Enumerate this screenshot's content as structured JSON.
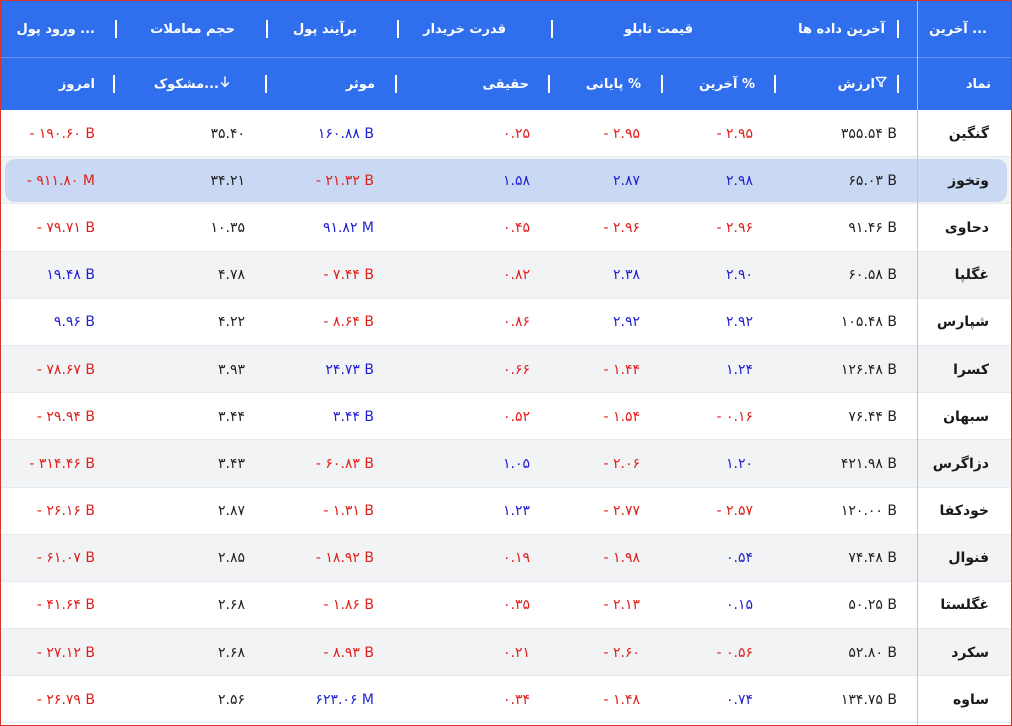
{
  "header_top": {
    "last": "آخرین ...",
    "last_data": "آخرین داده ها",
    "board_price": "قیمت تابلو",
    "buyer_power": "قدرت خریدار",
    "money_flow": "برآیند پول",
    "trade_volume": "حجم معاملات",
    "money_inflow": "ورود پول ..."
  },
  "header_sub": {
    "symbol": "نماد",
    "value": "ارزش",
    "last_pct": "آخرین %",
    "close_pct": "پایانی %",
    "real": "حقیقی",
    "effective": "موثر",
    "suspect": "مشکوک...",
    "today": "امروز"
  },
  "icons": {
    "filter": "filter-icon",
    "sort": "arrow-down-icon"
  },
  "colors": {
    "header_bg": "#2f6fed",
    "negative": "#e0201b",
    "positive": "#1f1fd1",
    "selected_row": "#c9d8f3"
  },
  "selected_row_index": 1,
  "rows": [
    {
      "symbol": "گنگین",
      "value": "۳۵۵.۵۴ B",
      "last_pct": "- ۲.۹۵",
      "close_pct": "- ۲.۹۵",
      "real": "۰.۲۵",
      "effective": "۱۶۰.۸۸ B",
      "suspect": "۳۵.۴۰",
      "today": "- ۱۹۰.۶۰ B",
      "c": [
        "neg",
        "neg",
        "neg",
        "pos",
        "neu",
        "neg"
      ]
    },
    {
      "symbol": "وتخوز",
      "value": "۶۵.۰۳ B",
      "last_pct": "۲.۹۸",
      "close_pct": "۲.۸۷",
      "real": "۱.۵۸",
      "effective": "- ۲۱.۳۲ B",
      "suspect": "۳۴.۲۱",
      "today": "- ۹۱۱.۸۰ M",
      "c": [
        "pos",
        "pos",
        "pos",
        "neg",
        "neu",
        "neg"
      ]
    },
    {
      "symbol": "دحاوی",
      "value": "۹۱.۴۶ B",
      "last_pct": "- ۲.۹۶",
      "close_pct": "- ۲.۹۶",
      "real": "۰.۴۵",
      "effective": "۹۱.۸۲ M",
      "suspect": "۱۰.۳۵",
      "today": "- ۷۹.۷۱ B",
      "c": [
        "neg",
        "neg",
        "neg",
        "pos",
        "neu",
        "neg"
      ]
    },
    {
      "symbol": "غگلپا",
      "value": "۶۰.۵۸ B",
      "last_pct": "۲.۹۰",
      "close_pct": "۲.۳۸",
      "real": "۰.۸۲",
      "effective": "- ۷.۴۴ B",
      "suspect": "۴.۷۸",
      "today": "۱۹.۴۸ B",
      "c": [
        "pos",
        "pos",
        "neg",
        "neg",
        "neu",
        "pos"
      ]
    },
    {
      "symbol": "شپارس",
      "value": "۱۰۵.۴۸ B",
      "last_pct": "۲.۹۲",
      "close_pct": "۲.۹۲",
      "real": "۰.۸۶",
      "effective": "- ۸.۶۴ B",
      "suspect": "۴.۲۲",
      "today": "۹.۹۶ B",
      "c": [
        "pos",
        "pos",
        "neg",
        "neg",
        "neu",
        "pos"
      ]
    },
    {
      "symbol": "کسرا",
      "value": "۱۲۶.۴۸ B",
      "last_pct": "۱.۲۴",
      "close_pct": "- ۱.۴۴",
      "real": "۰.۶۶",
      "effective": "۲۴.۷۳ B",
      "suspect": "۳.۹۳",
      "today": "- ۷۸.۶۷ B",
      "c": [
        "pos",
        "neg",
        "neg",
        "pos",
        "neu",
        "neg"
      ]
    },
    {
      "symbol": "سبهان",
      "value": "۷۶.۴۴ B",
      "last_pct": "- ۰.۱۶",
      "close_pct": "- ۱.۵۴",
      "real": "۰.۵۲",
      "effective": "۳.۴۴ B",
      "suspect": "۳.۴۴",
      "today": "- ۲۹.۹۴ B",
      "c": [
        "neg",
        "neg",
        "neg",
        "pos",
        "neu",
        "neg"
      ]
    },
    {
      "symbol": "دزاگرس",
      "value": "۴۲۱.۹۸ B",
      "last_pct": "۱.۲۰",
      "close_pct": "- ۲.۰۶",
      "real": "۱.۰۵",
      "effective": "- ۶۰.۸۳ B",
      "suspect": "۳.۴۳",
      "today": "- ۳۱۴.۴۶ B",
      "c": [
        "pos",
        "neg",
        "pos",
        "neg",
        "neu",
        "neg"
      ]
    },
    {
      "symbol": "خودکفا",
      "value": "۱۲۰.۰۰ B",
      "last_pct": "- ۲.۵۷",
      "close_pct": "- ۲.۷۷",
      "real": "۱.۲۳",
      "effective": "- ۱.۳۱ B",
      "suspect": "۲.۸۷",
      "today": "- ۲۶.۱۶ B",
      "c": [
        "neg",
        "neg",
        "pos",
        "neg",
        "neu",
        "neg"
      ]
    },
    {
      "symbol": "فنوال",
      "value": "۷۴.۴۸ B",
      "last_pct": "۰.۵۴",
      "close_pct": "- ۱.۹۸",
      "real": "۰.۱۹",
      "effective": "- ۱۸.۹۲ B",
      "suspect": "۲.۸۵",
      "today": "- ۶۱.۰۷ B",
      "c": [
        "pos",
        "neg",
        "neg",
        "neg",
        "neu",
        "neg"
      ]
    },
    {
      "symbol": "غگلستا",
      "value": "۵۰.۲۵ B",
      "last_pct": "۰.۱۵",
      "close_pct": "- ۲.۱۳",
      "real": "۰.۳۵",
      "effective": "- ۱.۸۶ B",
      "suspect": "۲.۶۸",
      "today": "- ۴۱.۶۴ B",
      "c": [
        "pos",
        "neg",
        "neg",
        "neg",
        "neu",
        "neg"
      ]
    },
    {
      "symbol": "سکرد",
      "value": "۵۲.۸۰ B",
      "last_pct": "- ۰.۵۶",
      "close_pct": "- ۲.۶۰",
      "real": "۰.۲۱",
      "effective": "- ۸.۹۳ B",
      "suspect": "۲.۶۸",
      "today": "- ۲۷.۱۲ B",
      "c": [
        "neg",
        "neg",
        "neg",
        "neg",
        "neu",
        "neg"
      ]
    },
    {
      "symbol": "ساوه",
      "value": "۱۳۴.۷۵ B",
      "last_pct": "۰.۷۴",
      "close_pct": "- ۱.۴۸",
      "real": "۰.۳۴",
      "effective": "۶۲۳.۰۶ M",
      "suspect": "۲.۵۶",
      "today": "- ۲۶.۷۹ B",
      "c": [
        "pos",
        "neg",
        "neg",
        "pos",
        "neu",
        "neg"
      ]
    }
  ]
}
